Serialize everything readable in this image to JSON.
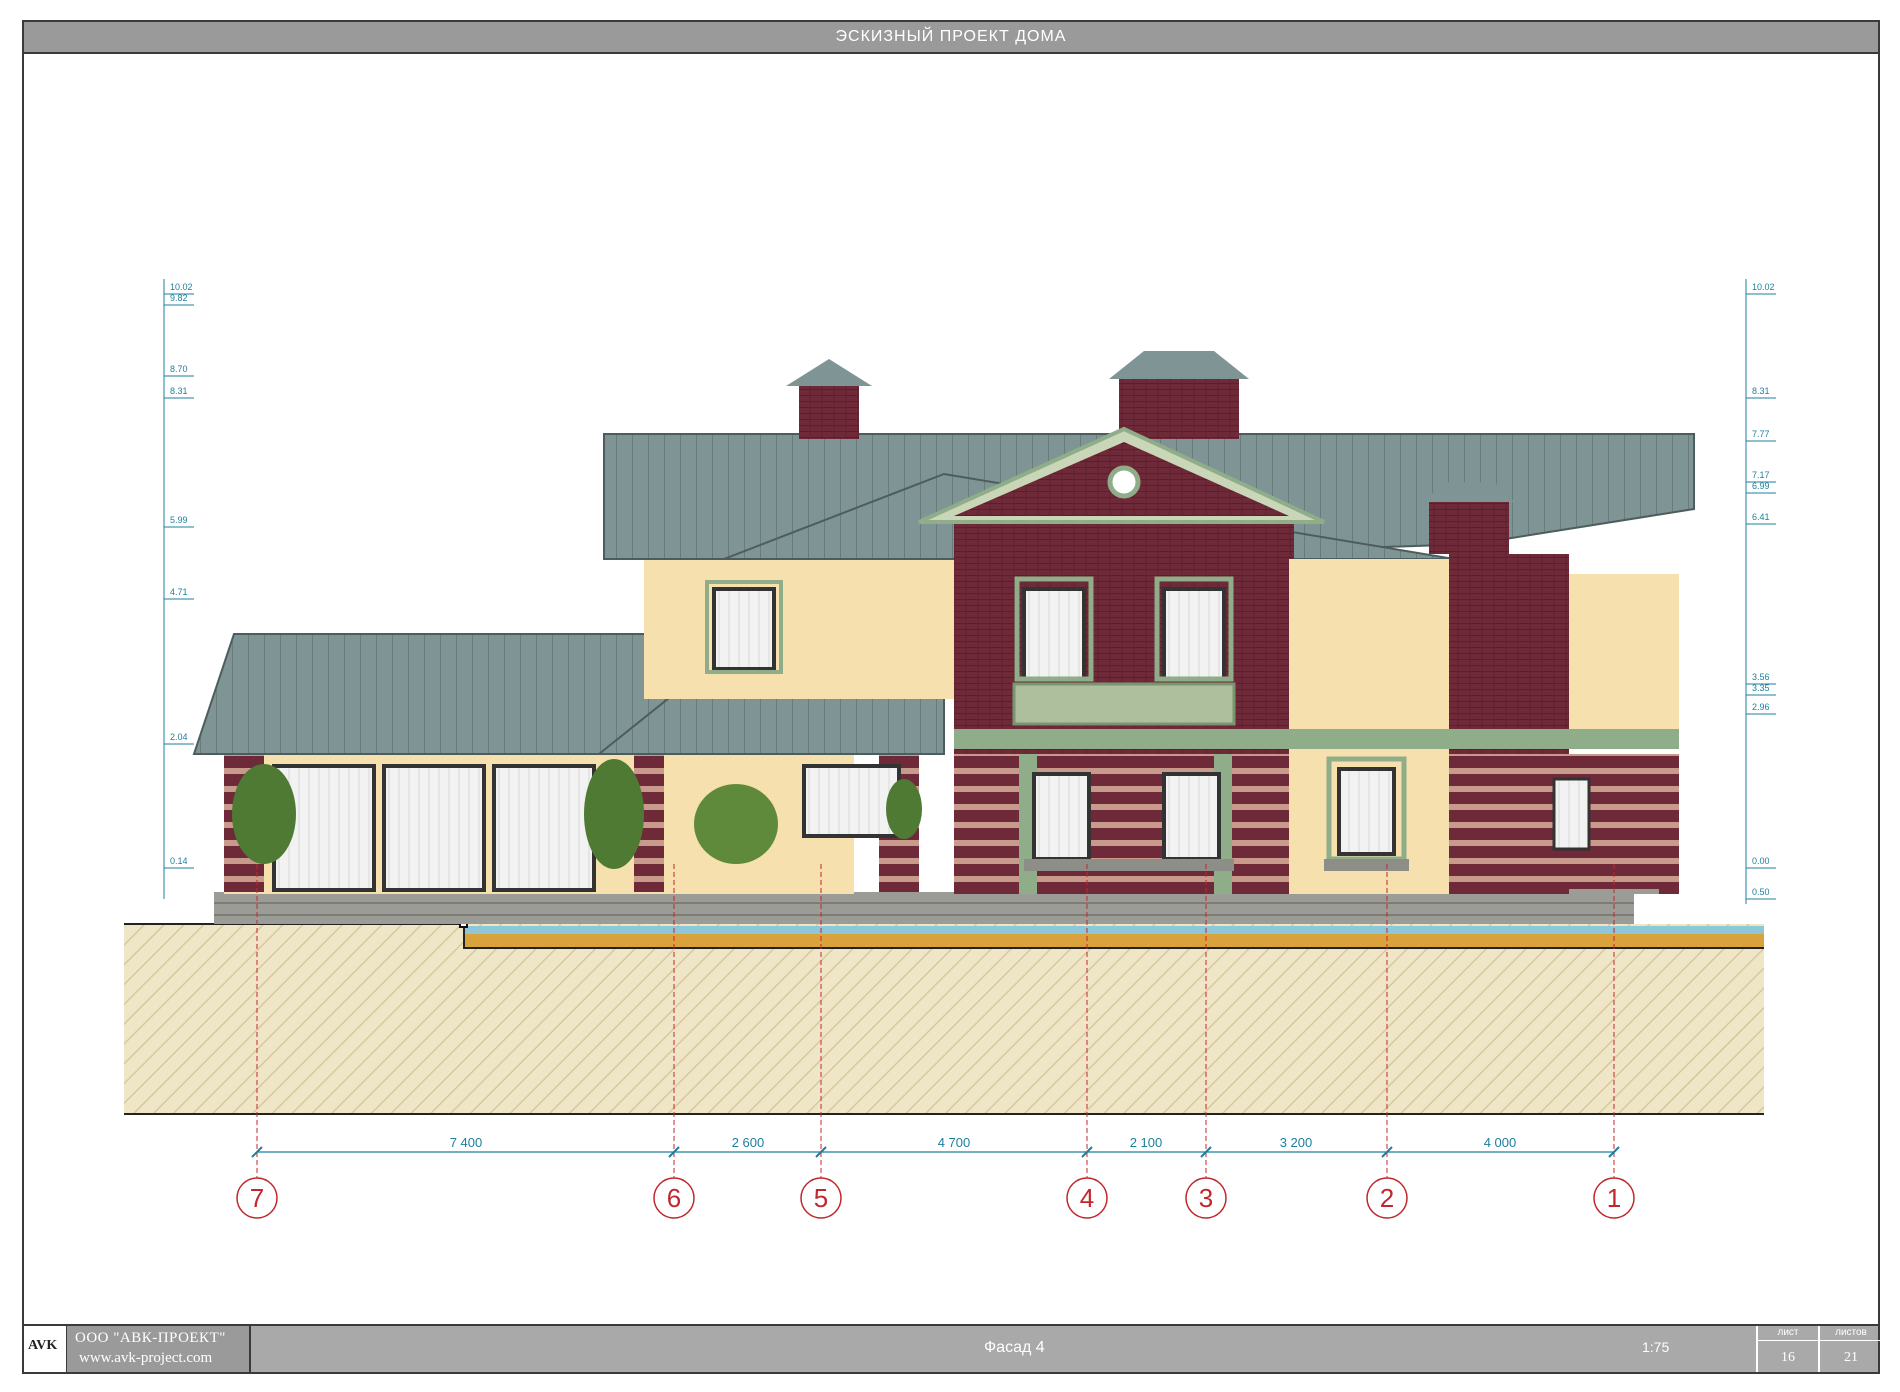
{
  "title": "ЭСКИЗНЫЙ ПРОЕКТ ДОМА",
  "levels_left": [
    "10.02",
    "9.82",
    "8.70",
    "8.31",
    "5.99",
    "4.71",
    "2.04",
    "0.14"
  ],
  "levels_right": [
    "10.02",
    "8.31",
    "7.77",
    "7.17",
    "6.99",
    "6.41",
    "3.56",
    "3.35",
    "2.96",
    "0.00",
    "0.50"
  ],
  "axes": [
    "7",
    "6",
    "5",
    "4",
    "3",
    "2",
    "1"
  ],
  "dimensions": [
    "7 400",
    "2 600",
    "4 700",
    "2 100",
    "3 200",
    "4 000"
  ],
  "footer": {
    "logo_text": "AVK",
    "company": "ООО \"АВК-ПРОЕКТ\"",
    "website": "www.avk-project.com",
    "sheet_name": "Фасад 4",
    "scale": "1:75",
    "sheet_label": "лист",
    "sheets_label": "листов",
    "sheet_no": "16",
    "sheets_total": "21"
  },
  "colors": {
    "roof": "#7f9494",
    "brick": "#6e2a38",
    "stucco": "#f6e0ad",
    "trim": "#8fad88",
    "ground": "#efe6c8",
    "axis_red": "#c0282d",
    "dim_blue": "#1d7f9e"
  }
}
